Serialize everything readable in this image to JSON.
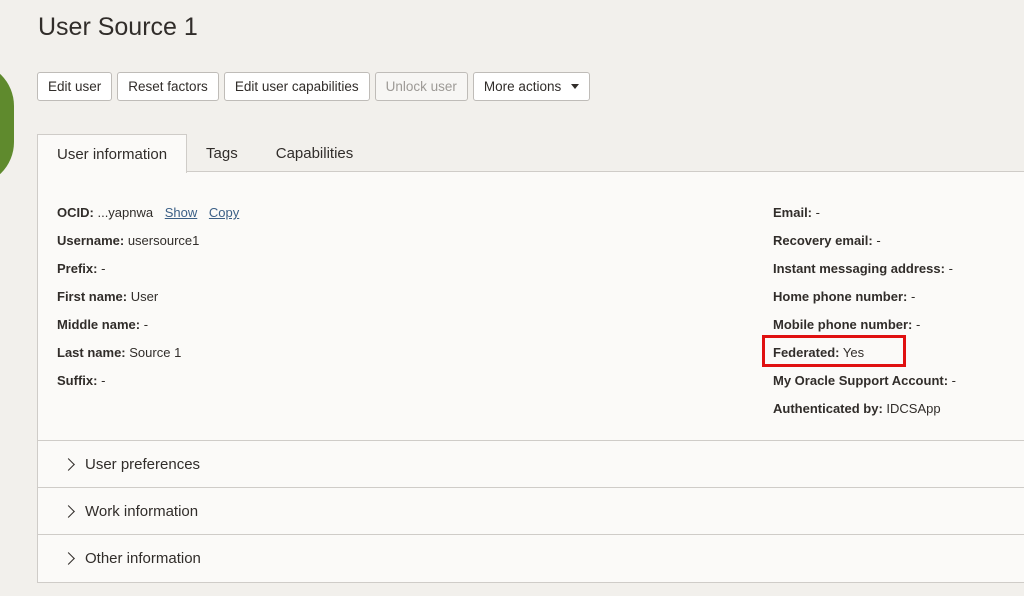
{
  "page": {
    "title": "User Source 1"
  },
  "toolbar": {
    "edit_user": "Edit user",
    "reset_factors": "Reset factors",
    "edit_capabilities": "Edit user capabilities",
    "unlock_user": "Unlock user",
    "more_actions": "More actions"
  },
  "tabs": [
    {
      "label": "User information",
      "active": true
    },
    {
      "label": "Tags",
      "active": false
    },
    {
      "label": "Capabilities",
      "active": false
    }
  ],
  "info_left": [
    {
      "label": "OCID:",
      "value": "...yapnwa"
    },
    {
      "label": "Username:",
      "value": "usersource1"
    },
    {
      "label": "Prefix:",
      "value": "-"
    },
    {
      "label": "First name:",
      "value": "User"
    },
    {
      "label": "Middle name:",
      "value": "-"
    },
    {
      "label": "Last name:",
      "value": "Source 1"
    },
    {
      "label": "Suffix:",
      "value": "-"
    }
  ],
  "ocid_links": {
    "show": "Show",
    "copy": "Copy"
  },
  "info_right": [
    {
      "label": "Email:",
      "value": "-"
    },
    {
      "label": "Recovery email:",
      "value": "-"
    },
    {
      "label": "Instant messaging address:",
      "value": "-"
    },
    {
      "label": "Home phone number:",
      "value": "-"
    },
    {
      "label": "Mobile phone number:",
      "value": "-"
    },
    {
      "label": "Federated:",
      "value": "Yes"
    },
    {
      "label": "My Oracle Support Account:",
      "value": "-"
    },
    {
      "label": "Authenticated by:",
      "value": "IDCSApp"
    }
  ],
  "sections": [
    {
      "label": "User preferences"
    },
    {
      "label": "Work information"
    },
    {
      "label": "Other information"
    }
  ],
  "colors": {
    "highlight": "#e01010",
    "avatar": "#5f8a2d",
    "link": "#3b5f86"
  }
}
